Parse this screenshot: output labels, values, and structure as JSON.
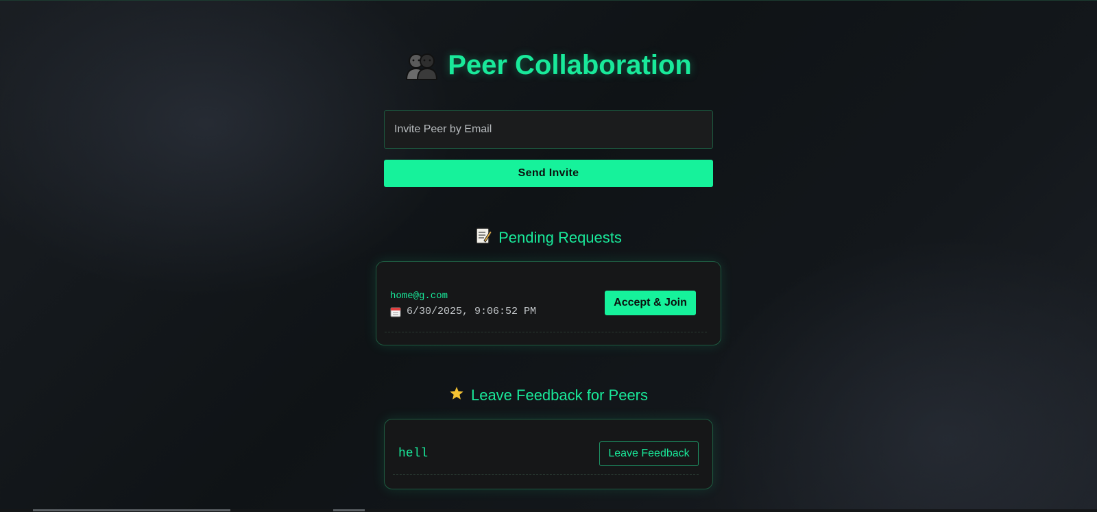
{
  "header": {
    "title": "Peer Collaboration",
    "icon": "people-icon"
  },
  "invite": {
    "placeholder": "Invite Peer by Email",
    "value": "",
    "send_label": "Send Invite"
  },
  "pending": {
    "heading": "Pending Requests",
    "icon": "memo-icon",
    "requests": [
      {
        "email": "home@g.com",
        "date": "6/30/2025, 9:06:52 PM",
        "date_icon": "calendar-icon",
        "action_label": "Accept & Join"
      }
    ]
  },
  "feedback": {
    "heading": "Leave Feedback for Peers",
    "icon": "star-icon",
    "peers": [
      {
        "name": "hell",
        "action_label": "Leave Feedback"
      }
    ]
  },
  "colors": {
    "accent": "#16f29b",
    "accent_text": "#19e99a",
    "background": "#0f1316",
    "card": "#161718",
    "star": "#f5c332"
  }
}
